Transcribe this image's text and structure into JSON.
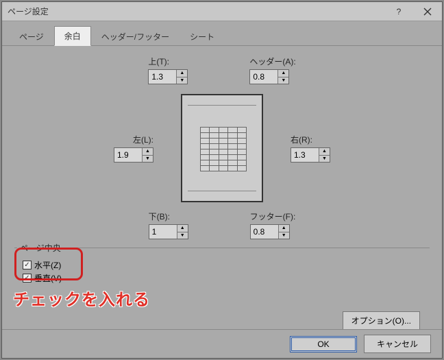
{
  "dialog": {
    "title": "ページ設定"
  },
  "tabs": {
    "page": "ページ",
    "margins": "余白",
    "headerfooter": "ヘッダー/フッター",
    "sheet": "シート"
  },
  "margins": {
    "top_label": "上(T):",
    "top_value": "1.3",
    "header_label": "ヘッダー(A):",
    "header_value": "0.8",
    "left_label": "左(L):",
    "left_value": "1.9",
    "right_label": "右(R):",
    "right_value": "1.3",
    "bottom_label": "下(B):",
    "bottom_value": "1",
    "footer_label": "フッター(F):",
    "footer_value": "0.8"
  },
  "center": {
    "legend": "ページ中央",
    "horizontal": "水平(Z)",
    "vertical": "垂直(V)"
  },
  "annotation": "チェックを入れる",
  "buttons": {
    "options": "オプション(O)...",
    "ok": "OK",
    "cancel": "キャンセル"
  }
}
